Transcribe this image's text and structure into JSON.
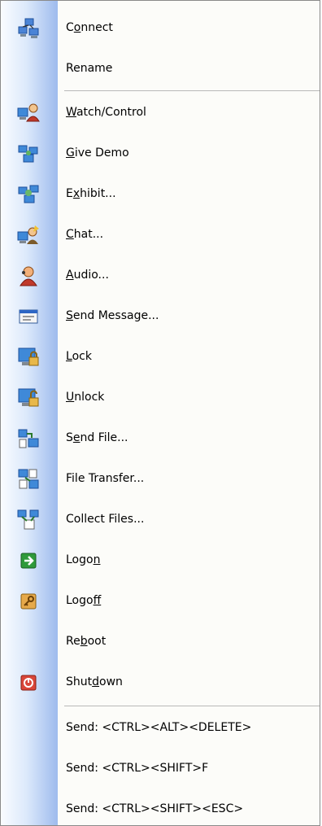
{
  "menu": {
    "items": [
      {
        "id": "connect",
        "label": "Connect",
        "mnemonic": "o",
        "icon": "network-computers-icon"
      },
      {
        "id": "rename",
        "label": "Rename",
        "mnemonic": "",
        "icon": ""
      },
      {
        "id": "watch-control",
        "label": "Watch/Control",
        "mnemonic": "W",
        "icon": "watch-control-icon"
      },
      {
        "id": "give-demo",
        "label": "Give Demo",
        "mnemonic": "G",
        "icon": "give-demo-icon"
      },
      {
        "id": "exhibit",
        "label": "Exhibit...",
        "mnemonic": "x",
        "icon": "exhibit-icon"
      },
      {
        "id": "chat",
        "label": "Chat...",
        "mnemonic": "C",
        "icon": "chat-icon"
      },
      {
        "id": "audio",
        "label": "Audio...",
        "mnemonic": "A",
        "icon": "audio-icon"
      },
      {
        "id": "send-message",
        "label": "Send Message...",
        "mnemonic": "S",
        "icon": "message-window-icon"
      },
      {
        "id": "lock",
        "label": "Lock",
        "mnemonic": "L",
        "icon": "lock-computer-icon"
      },
      {
        "id": "unlock",
        "label": "Unlock",
        "mnemonic": "U",
        "icon": "unlock-computer-icon"
      },
      {
        "id": "send-file",
        "label": "Send File...",
        "mnemonic": "e",
        "icon": "send-file-icon"
      },
      {
        "id": "file-transfer",
        "label": "File Transfer...",
        "mnemonic": "",
        "icon": "file-transfer-icon"
      },
      {
        "id": "collect-files",
        "label": "Collect Files...",
        "mnemonic": "",
        "icon": "collect-files-icon"
      },
      {
        "id": "logon",
        "label": "Logon",
        "mnemonic": "n",
        "icon": "logon-arrow-icon"
      },
      {
        "id": "logoff",
        "label": "Logoff",
        "mnemonic": "f",
        "icon": "logoff-key-icon"
      },
      {
        "id": "reboot",
        "label": "Reboot",
        "mnemonic": "b",
        "icon": ""
      },
      {
        "id": "shutdown",
        "label": "Shutdown",
        "mnemonic": "d",
        "icon": "power-icon"
      },
      {
        "id": "send-ctrl-alt-delete",
        "label": "Send: <CTRL><ALT><DELETE>",
        "mnemonic": "",
        "icon": ""
      },
      {
        "id": "send-ctrl-shift-f",
        "label": "Send: <CTRL><SHIFT>F",
        "mnemonic": "",
        "icon": ""
      },
      {
        "id": "send-ctrl-shift-esc",
        "label": "Send: <CTRL><SHIFT><ESC>",
        "mnemonic": "",
        "icon": ""
      }
    ]
  },
  "colors": {
    "gutter_light": "#fafcff",
    "gutter_dark": "#9ebbed",
    "menu_bg": "#fcfcf9",
    "separator": "#b8b8b8"
  }
}
